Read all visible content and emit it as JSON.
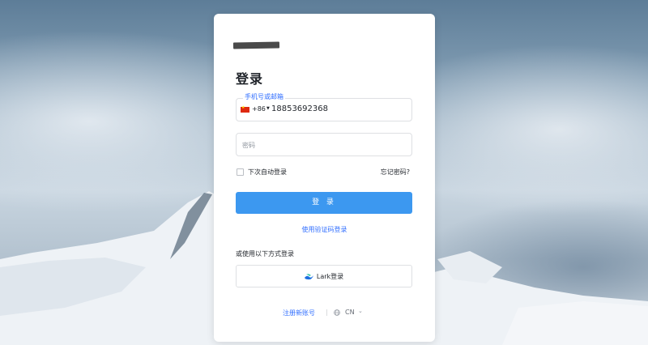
{
  "logo_alt": "redacted-logo",
  "form": {
    "title": "登录",
    "phone": {
      "label": "手机号或邮箱",
      "country_code": "+86",
      "value": "18853692368"
    },
    "password": {
      "placeholder": "密码"
    },
    "remember_label": "下次自动登录",
    "forgot_label": "忘记密码?",
    "login_button": "登 录",
    "code_login_link": "使用验证码登录",
    "alt_login_label": "或使用以下方式登录",
    "lark_button": "Lark登录"
  },
  "footer": {
    "register_link": "注册新账号",
    "divider": "|",
    "language": "CN"
  },
  "colors": {
    "accent": "#3c98f0",
    "link": "#3370ff",
    "text": "#1f2329",
    "border": "#dee0e3"
  },
  "icons": [
    "china-flag-icon",
    "caret-down-icon",
    "lark-icon",
    "globe-icon",
    "chevron-down-icon"
  ]
}
